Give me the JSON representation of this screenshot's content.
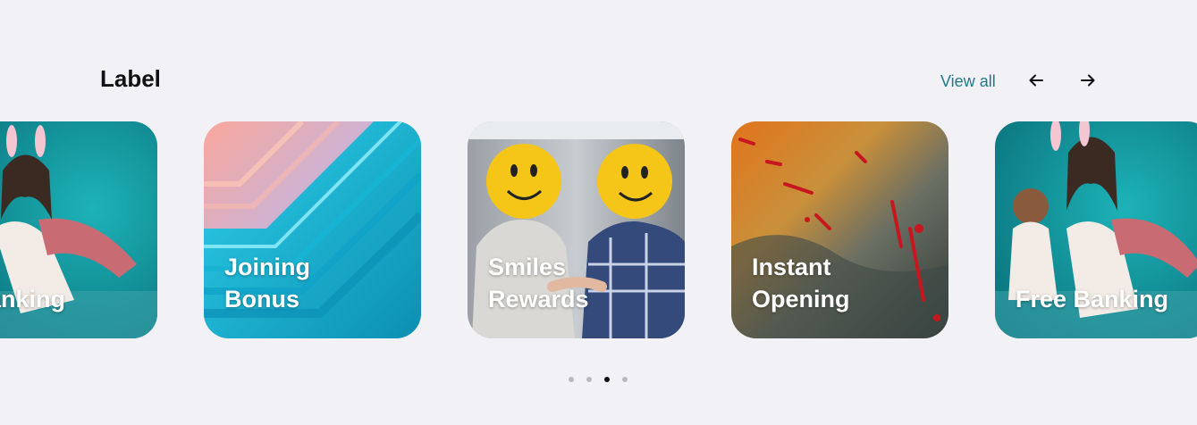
{
  "header": {
    "title": "Label",
    "view_all": "View all"
  },
  "cards": [
    {
      "line1": "Free Banking",
      "line2": ""
    },
    {
      "line1": "Joining",
      "line2": "Bonus"
    },
    {
      "line1": "Smiles",
      "line2": "Rewards"
    },
    {
      "line1": "Instant",
      "line2": "Opening"
    },
    {
      "line1": "Free Banking",
      "line2": ""
    }
  ],
  "pagination": {
    "count": 4,
    "active_index": 2
  },
  "colors": {
    "accent": "#1f7a88",
    "background": "#f2f1f6",
    "teal": "#0f8f96"
  },
  "icons": {
    "prev": "arrow-left-icon",
    "next": "arrow-right-icon"
  }
}
